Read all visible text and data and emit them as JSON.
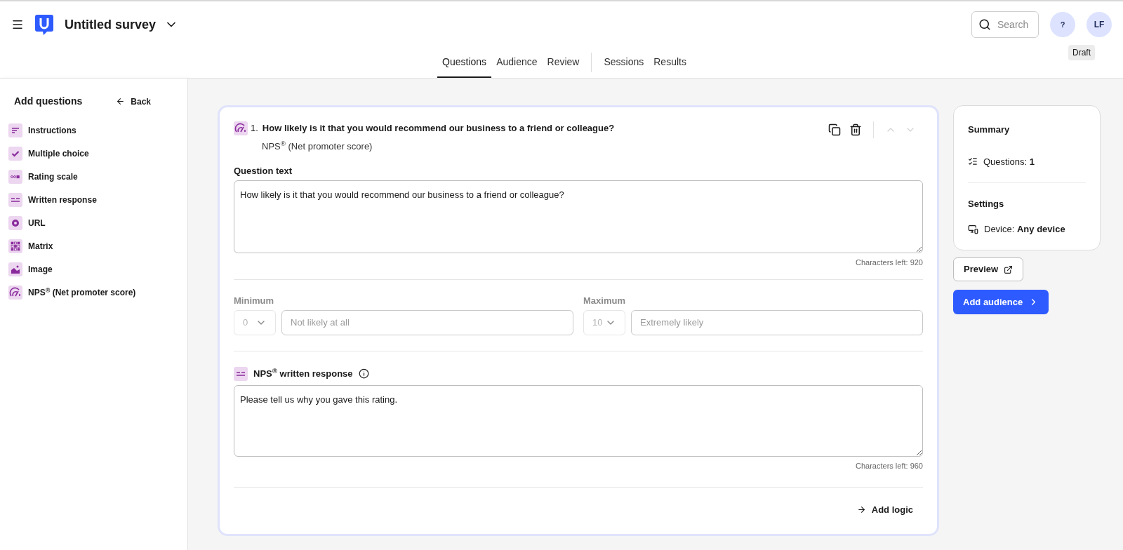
{
  "header": {
    "survey_title": "Untitled survey",
    "search": {
      "placeholder": "Search"
    },
    "help_label": "?",
    "avatar_initials": "LF"
  },
  "tabs": [
    {
      "label": "Questions",
      "selected": true
    },
    {
      "label": "Audience",
      "selected": false
    },
    {
      "label": "Review",
      "selected": false
    },
    {
      "label": "Sessions",
      "selected": false
    },
    {
      "label": "Results",
      "selected": false
    }
  ],
  "status_badge": "Draft",
  "sidebar": {
    "title": "Add questions",
    "back_label": "Back",
    "items": [
      {
        "kind": "instructions",
        "label": "Instructions"
      },
      {
        "kind": "multiple_choice",
        "label": "Multiple choice"
      },
      {
        "kind": "rating",
        "label": "Rating scale"
      },
      {
        "kind": "written",
        "label": "Written response"
      },
      {
        "kind": "url",
        "label": "URL"
      },
      {
        "kind": "matrix",
        "label": "Matrix"
      },
      {
        "kind": "image",
        "label": "Image"
      },
      {
        "kind": "nps",
        "label": "NPS$^{®}$ (Net promoter score)"
      }
    ]
  },
  "question": {
    "number": "1.",
    "title": "How likely is it that you would recommend our business to a friend or colleague?",
    "type_label": "NPS$^{®}$ (Net promoter score)",
    "move_up_disabled": true,
    "move_down_disabled": true,
    "question_text_label": "Question text",
    "question_text_value": "How likely is it that you would recommend our business to a friend or colleague?",
    "question_chars_left": "Characters left: 920",
    "scale": [
      {
        "label": "Minimum",
        "value": "0",
        "disabled": true,
        "placeholder": "Not likely at all"
      },
      {
        "label": "Maximum",
        "value": "10",
        "disabled": true,
        "placeholder": "Extremely likely"
      }
    ],
    "followup_label": "NPS$^{®}$ written response",
    "followup_value": "Please tell us why you gave this rating.",
    "followup_chars_left": "Characters left: 960",
    "add_logic_label": "Add logic"
  },
  "summary": {
    "title": "Summary",
    "questions_label": "Questions:",
    "questions_count": "1",
    "settings_title": "Settings",
    "device_label": "Device:",
    "device_value": "Any device"
  },
  "preview_label": "Preview",
  "add_audience_label": "Add audience"
}
